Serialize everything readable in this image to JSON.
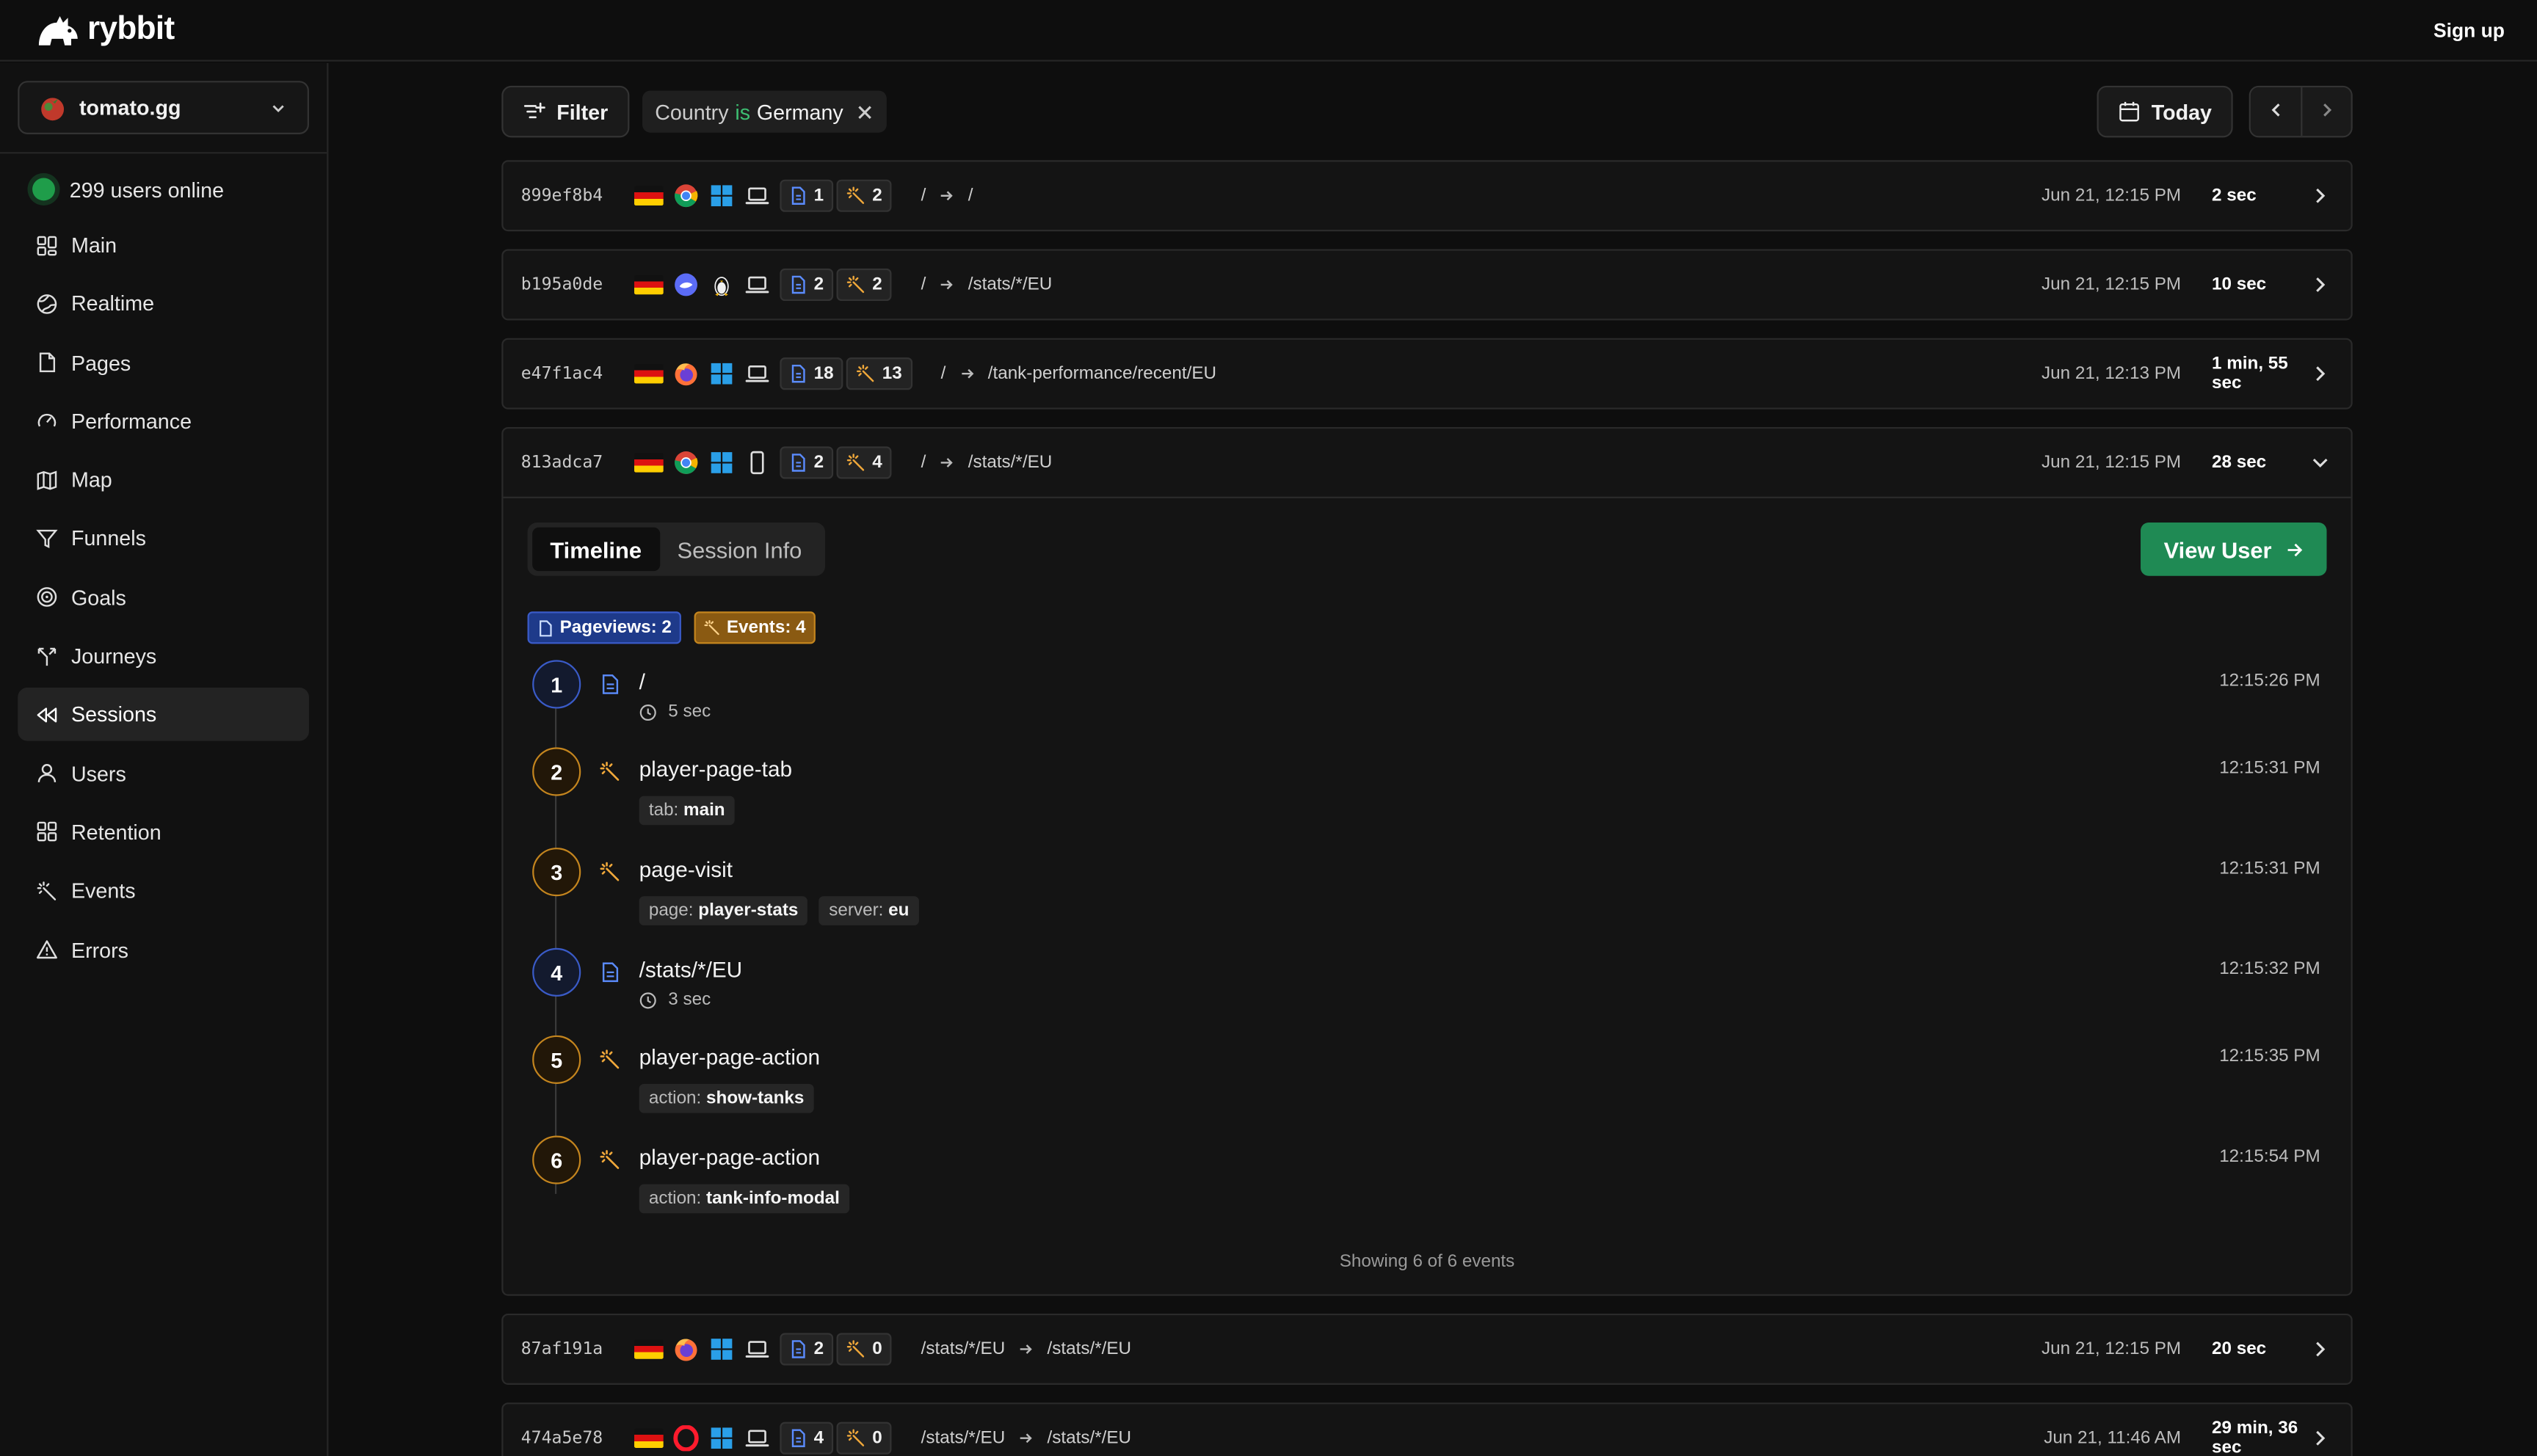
{
  "app": {
    "brand": "rybbit",
    "signup_label": "Sign up"
  },
  "sidebar": {
    "site": "tomato.gg",
    "online_text": "299 users online",
    "items": [
      {
        "label": "Main",
        "icon": "grid-icon"
      },
      {
        "label": "Realtime",
        "icon": "globe-icon"
      },
      {
        "label": "Pages",
        "icon": "file-icon"
      },
      {
        "label": "Performance",
        "icon": "gauge-icon"
      },
      {
        "label": "Map",
        "icon": "map-icon"
      },
      {
        "label": "Funnels",
        "icon": "funnel-icon"
      },
      {
        "label": "Goals",
        "icon": "target-icon"
      },
      {
        "label": "Journeys",
        "icon": "split-icon"
      },
      {
        "label": "Sessions",
        "icon": "rewind-icon",
        "active": true
      },
      {
        "label": "Users",
        "icon": "user-icon"
      },
      {
        "label": "Retention",
        "icon": "grid-icon"
      },
      {
        "label": "Events",
        "icon": "sparkle-icon"
      },
      {
        "label": "Errors",
        "icon": "alert-icon"
      }
    ]
  },
  "toolbar": {
    "filter_label": "Filter",
    "chip": {
      "field": "Country",
      "op": "is",
      "value": "Germany"
    },
    "date_label": "Today"
  },
  "sessions": [
    {
      "id": "899ef8b4",
      "browser": "chrome",
      "os": "windows",
      "device": "laptop",
      "pageviews": "1",
      "events": "2",
      "entry": "/",
      "exit": "/",
      "date": "Jun 21, 12:15 PM",
      "duration": "2 sec"
    },
    {
      "id": "b195a0de",
      "browser": "other",
      "os": "linux",
      "device": "laptop",
      "pageviews": "2",
      "events": "2",
      "entry": "/",
      "exit": "/stats/*/EU",
      "date": "Jun 21, 12:15 PM",
      "duration": "10 sec"
    },
    {
      "id": "e47f1ac4",
      "browser": "firefox",
      "os": "windows",
      "device": "laptop",
      "pageviews": "18",
      "events": "13",
      "entry": "/",
      "exit": "/tank-performance/recent/EU",
      "date": "Jun 21, 12:13 PM",
      "duration": "1 min, 55 sec"
    },
    {
      "id": "813adca7",
      "browser": "chrome",
      "os": "windows",
      "device": "mobile",
      "pageviews": "2",
      "events": "4",
      "entry": "/",
      "exit": "/stats/*/EU",
      "date": "Jun 21, 12:15 PM",
      "duration": "28 sec"
    },
    {
      "id": "87af191a",
      "browser": "firefox",
      "os": "windows",
      "device": "laptop",
      "pageviews": "2",
      "events": "0",
      "entry": "/stats/*/EU",
      "exit": "/stats/*/EU",
      "date": "Jun 21, 12:15 PM",
      "duration": "20 sec"
    },
    {
      "id": "474a5e78",
      "browser": "opera",
      "os": "windows",
      "device": "laptop",
      "pageviews": "4",
      "events": "0",
      "entry": "/stats/*/EU",
      "exit": "/stats/*/EU",
      "date": "Jun 21, 11:46 AM",
      "duration": "29 min, 36 sec"
    }
  ],
  "detail": {
    "tabs": [
      "Timeline",
      "Session Info"
    ],
    "view_user_label": "View User",
    "pageviews_label": "Pageviews: 2",
    "events_label": "Events: 4",
    "events": [
      {
        "n": "1",
        "kind": "pageview",
        "title": "/",
        "duration": "5 sec",
        "time": "12:15:26 PM"
      },
      {
        "n": "2",
        "kind": "event",
        "title": "player-page-tab",
        "props": [
          {
            "k": "tab:",
            "v": "main"
          }
        ],
        "time": "12:15:31 PM"
      },
      {
        "n": "3",
        "kind": "event",
        "title": "page-visit",
        "props": [
          {
            "k": "page:",
            "v": "player-stats"
          },
          {
            "k": "server:",
            "v": "eu"
          }
        ],
        "time": "12:15:31 PM"
      },
      {
        "n": "4",
        "kind": "pageview",
        "title": "/stats/*/EU",
        "duration": "3 sec",
        "time": "12:15:32 PM"
      },
      {
        "n": "5",
        "kind": "event",
        "title": "player-page-action",
        "props": [
          {
            "k": "action:",
            "v": "show-tanks"
          }
        ],
        "time": "12:15:35 PM"
      },
      {
        "n": "6",
        "kind": "event",
        "title": "player-page-action",
        "props": [
          {
            "k": "action:",
            "v": "tank-info-modal"
          }
        ],
        "time": "12:15:54 PM"
      }
    ],
    "showing_text": "Showing 6 of 6 events"
  },
  "colors": {
    "accent": "#1f8a54",
    "pageview": "#3a5bc8",
    "event": "#c4851e",
    "online": "#1f9d4a"
  }
}
